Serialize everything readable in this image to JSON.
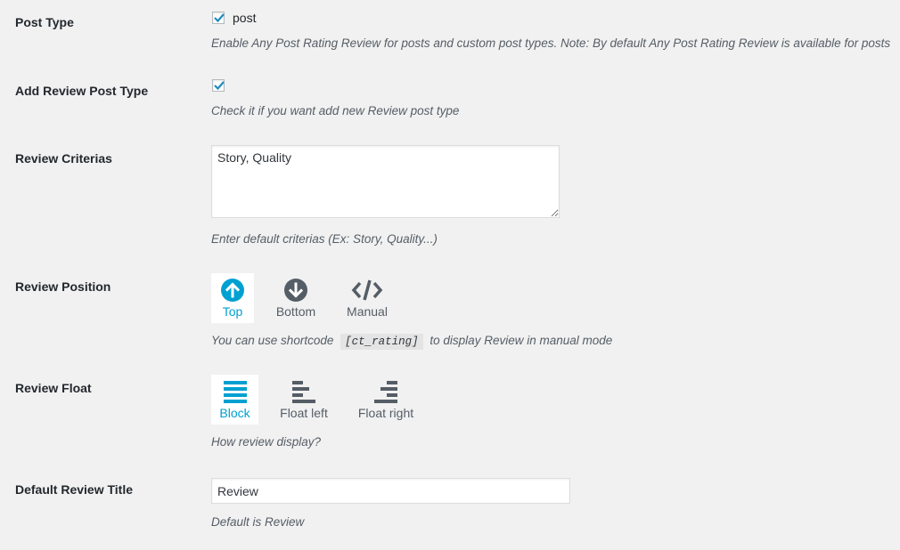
{
  "post_type": {
    "label": "Post Type",
    "checkbox_label": "post",
    "checked": true,
    "description": "Enable Any Post Rating Review for posts and custom post types. Note: By default Any Post Rating Review is available for posts"
  },
  "add_review_post_type": {
    "label": "Add Review Post Type",
    "checked": true,
    "description": "Check it if you want add new Review post type"
  },
  "review_criterias": {
    "label": "Review Criterias",
    "value": "Story, Quality",
    "description": "Enter default criterias (Ex: Story, Quality...)"
  },
  "review_position": {
    "label": "Review Position",
    "selected": "Top",
    "options": [
      {
        "label": "Top",
        "icon": "arrow-up-circle-icon"
      },
      {
        "label": "Bottom",
        "icon": "arrow-down-circle-icon"
      },
      {
        "label": "Manual",
        "icon": "code-icon"
      }
    ],
    "description_before": "You can use shortcode",
    "shortcode": "[ct_rating]",
    "description_after": "to display Review in manual mode"
  },
  "review_float": {
    "label": "Review Float",
    "selected": "Block",
    "options": [
      {
        "label": "Block",
        "icon": "align-block-icon"
      },
      {
        "label": "Float left",
        "icon": "align-left-icon"
      },
      {
        "label": "Float right",
        "icon": "align-right-icon"
      }
    ],
    "description": "How review display?"
  },
  "default_review_title": {
    "label": "Default Review Title",
    "value": "Review",
    "description": "Default is Review"
  },
  "colors": {
    "background": "#f1f1f1",
    "accent": "#00a0d2",
    "icon_dark": "#555d66",
    "checkmark": "#1e8cbe"
  }
}
